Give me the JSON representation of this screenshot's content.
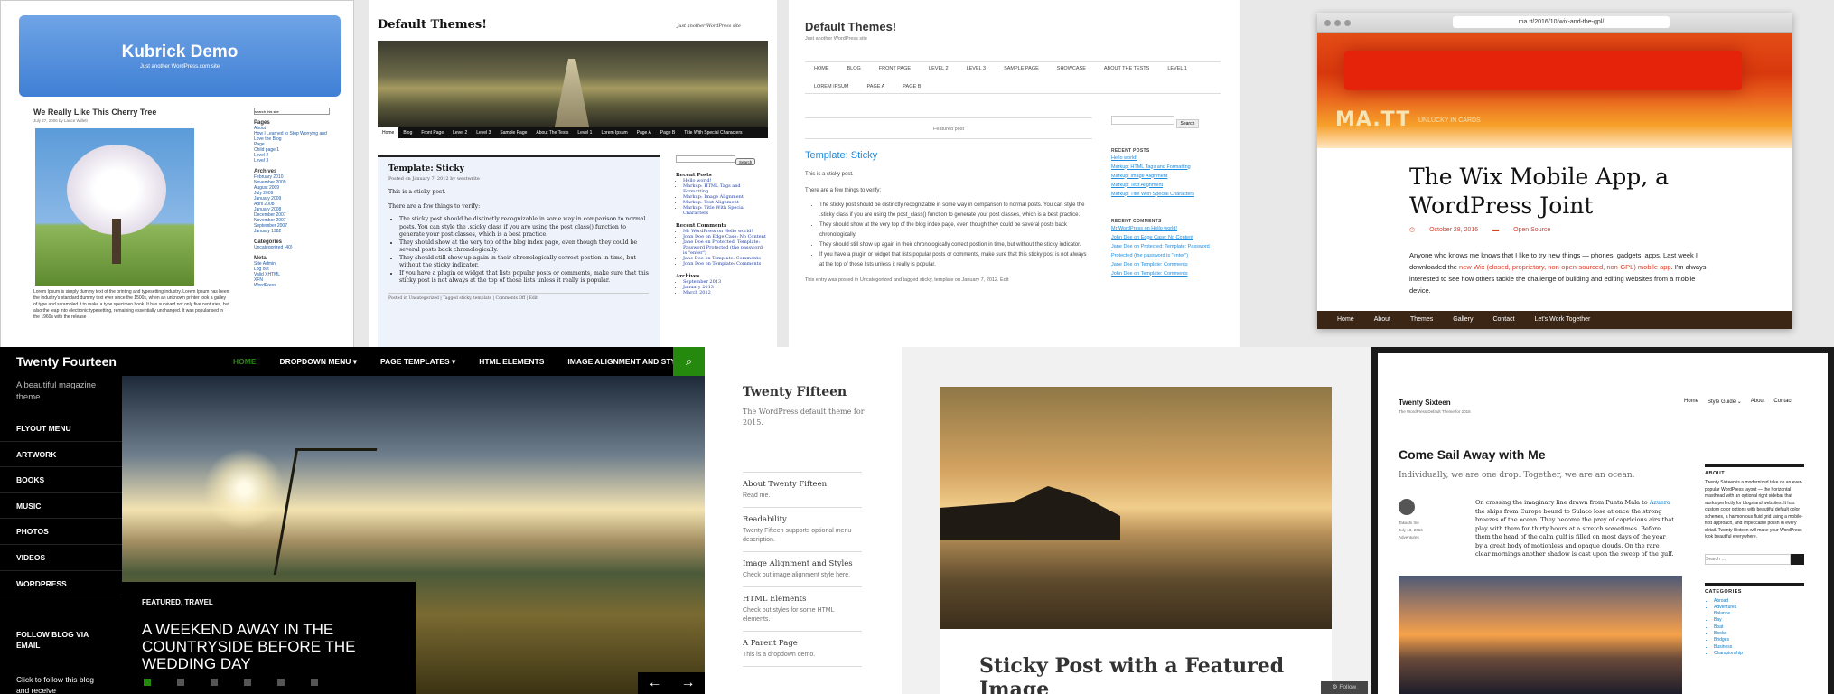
{
  "kubrick": {
    "title": "Kubrick Demo",
    "tagline": "Just another WordPress.com site",
    "post_title": "We Really Like This Cherry Tree",
    "post_meta": "July 27, 2006 by Lance Willett",
    "body": "Lorem Ipsum is simply dummy text of the printing and typesetting industry. Lorem Ipsum has been the industry's standard dummy text ever since the 1500s, when an unknown printer took a galley of type and scrambled it to make a type specimen book. It has survived not only five centuries, but also the leap into electronic typesetting, remaining essentially unchanged. It was popularised in the 1960s with the release",
    "search_value": "search this site",
    "pages_heading": "Pages",
    "pages": [
      "About",
      "How I Learned to Stop Worrying and Love the Blog",
      "Page",
      "Child page 1",
      "Level 2",
      "Level 3"
    ],
    "archives_heading": "Archives",
    "archives": [
      "February 2010",
      "November 2009",
      "August 2009",
      "July 2009",
      "January 2009",
      "April 2008",
      "January 2008",
      "December 2007",
      "November 2007",
      "September 2007",
      "January 1982"
    ],
    "categories_heading": "Categories",
    "categories": [
      "Uncategorized (40)"
    ],
    "meta_heading": "Meta",
    "meta": [
      "Site Admin",
      "Log out",
      "Valid XHTML",
      "XFN",
      "WordPress"
    ]
  },
  "default_serif": {
    "title": "Default Themes!",
    "tagline": "Just another WordPress site",
    "nav": [
      "Home",
      "Blog",
      "Front Page",
      "Level 2",
      "Level 3",
      "Sample Page",
      "About The Tests",
      "Level 1",
      "Lorem Ipsum",
      "Page A",
      "Page B",
      "Title With Special Characters"
    ],
    "post_title": "Template: Sticky",
    "post_meta": "Posted on January 7, 2012 by westwrite",
    "p1": "This is a sticky post.",
    "p2": "There are a few things to verify:",
    "bullets": [
      "The sticky post should be distinctly recognizable in some way in comparison to normal posts. You can style the .sticky class if you are using the post_class() function to generate your post classes, which is a best practice.",
      "They should show at the very top of the blog index page, even though they could be several posts back chronologically.",
      "They should still show up again in their chronologically correct postion in time, but without the sticky indicator.",
      "If you have a plugin or widget that lists popular posts or comments, make sure that this sticky post is not always at the top of those lists unless it really is popular."
    ],
    "foot": "Posted in Uncategorized | Tagged sticky, template | Comments Off | Edit",
    "search_button": "Search",
    "recent_posts_heading": "Recent Posts",
    "recent_posts": [
      "Hello world!",
      "Markup: HTML Tags and Formatting",
      "Markup: Image Alignment",
      "Markup: Text Alignment",
      "Markup: Title With Special Characters"
    ],
    "recent_comments_heading": "Recent Comments",
    "recent_comments": [
      "Mr WordPress on Hello world!",
      "John Doe on Edge Case: No Content",
      "Jane Doe on Protected: Template: Password Protected (the password is \"enter\")",
      "Jane Doe on Template: Comments",
      "John Doe on Template: Comments"
    ],
    "archives_heading": "Archives",
    "archives": [
      "September 2013",
      "January 2013",
      "March 2012"
    ]
  },
  "twenty_eleven": {
    "title": "Default Themes!",
    "tagline": "Just another WordPress site",
    "menu": [
      "HOME",
      "BLOG",
      "FRONT PAGE",
      "LEVEL 2",
      "LEVEL 3",
      "SAMPLE PAGE",
      "SHOWCASE",
      "ABOUT THE TESTS",
      "LEVEL 1",
      "LOREM IPSUM",
      "PAGE A",
      "PAGE B"
    ],
    "featured": "Featured post",
    "post_title": "Template: Sticky",
    "p1": "This is a sticky post.",
    "p2": "There are a few things to verify:",
    "bullets": [
      "The sticky post should be distinctly recognizable in some way in comparison to normal posts. You can style the .sticky class if you are using the post_class() function to generate your post classes, which is a best practice.",
      "They should show at the very top of the blog index page, even though they could be several posts back chronologically.",
      "They should still show up again in their chronologically correct postion in time, but without the sticky indicator.",
      "If you have a plugin or widget that lists popular posts or comments, make sure that this sticky post is not always at the top of those lists unless it really is popular."
    ],
    "foot": "This entry was posted in Uncategorized and tagged sticky, template on January 7, 2012. Edit",
    "search_button": "Search",
    "recent_posts_heading": "RECENT POSTS",
    "recent_posts": [
      "Hello world!",
      "Markup: HTML Tags and Formatting",
      "Markup: Image Alignment",
      "Markup: Text Alignment",
      "Markup: Title With Special Characters"
    ],
    "recent_comments_heading": "RECENT COMMENTS",
    "recent_comments": [
      "Mr WordPress on Hello world!",
      "John Doe on Edge Case: No Content",
      "Jane Doe on Protected: Template: Password Protected (the password is \"enter\")",
      "Jane Doe on Template: Comments",
      "John Doe on Template: Comments"
    ]
  },
  "matt": {
    "url": "ma.tt/2016/10/wix-and-the-gpl/",
    "logo": "MA.TT",
    "logo_tag": "UNLUCKY IN CARDS",
    "post_title": "The Wix Mobile App, a WordPress Joint",
    "date": "October 28, 2016",
    "category": "Open Source",
    "text_a": "Anyone who knows me knows that I like to try new things — phones, gadgets, apps. Last week I downloaded the ",
    "link": "new Wix (closed, proprietary, non-open-sourced, non-GPL) mobile app",
    "text_b": ". I'm always interested to see how others tackle the challenge of building and editing websites from a mobile device.",
    "footer_nav": [
      "Home",
      "About",
      "Themes",
      "Gallery",
      "Contact",
      "Let's Work Together"
    ]
  },
  "twenty_fourteen": {
    "site_title": "Twenty Fourteen",
    "description": "A beautiful magazine theme",
    "menu": [
      "HOME",
      "DROPDOWN MENU ▾",
      "PAGE TEMPLATES ▾",
      "HTML ELEMENTS",
      "IMAGE ALIGNMENT AND STYLES"
    ],
    "secondary_menu": [
      "FLYOUT MENU",
      "ARTWORK",
      "BOOKS",
      "MUSIC",
      "PHOTOS",
      "VIDEOS",
      "WORDPRESS"
    ],
    "follow_heading": "FOLLOW BLOG VIA EMAIL",
    "follow_text": "Click to follow this blog and receive",
    "featured_cat": "FEATURED, TRAVEL",
    "featured_title": "A WEEKEND AWAY IN THE COUNTRYSIDE BEFORE THE WEDDING DAY",
    "accent": "#24890d"
  },
  "twenty_fifteen": {
    "site_title": "Twenty Fifteen",
    "description": "The WordPress default theme for 2015.",
    "nav": [
      {
        "title": "About Twenty Fifteen",
        "sub": "Read me."
      },
      {
        "title": "Readability",
        "sub": "Twenty Fifteen supports optional menu description."
      },
      {
        "title": "Image Alignment and Styles",
        "sub": "Check out image alignment style here."
      },
      {
        "title": "HTML Elements",
        "sub": "Check out styles for some HTML elements."
      },
      {
        "title": "A Parent Page",
        "sub": "This is a dropdown demo."
      }
    ],
    "post_title": "Sticky Post with a Featured Image",
    "follow": "Follow"
  },
  "twenty_sixteen": {
    "site_title": "Twenty Sixteen",
    "description": "The WordPress Default Theme for 2016",
    "menu": [
      "Home",
      "Style Guide ⌄",
      "About",
      "Contact"
    ],
    "post_title": "Come Sail Away with Me",
    "excerpt": "Individually, we are one drop. Together, we are an ocean.",
    "author": "Takashi Irie",
    "date": "July 19, 2016",
    "category": "Adventures",
    "text_a": "On crossing the imaginary line drawn from Punta Mala to ",
    "link": "Azuera",
    "text_b": " the ships from Europe bound to Sulaco lose at once the strong breezes of the ocean. They become the prey of capricious airs that play with them for thirty hours at a stretch sometimes. Before them the head of the calm gulf is filled on most days of the year by a great body of motionless and opaque clouds. On the rare clear mornings another shadow is cast upon the sweep of the gulf.",
    "about_heading": "ABOUT",
    "about_text": "Twenty Sixteen is a modernized take on an ever-popular WordPress layout — the horizontal masthead with an optional right sidebar that works perfectly for blogs and websites. It has custom color options with beautiful default color schemes, a harmonious fluid grid using a mobile-first approach, and impeccable polish in every detail. Twenty Sixteen will make your WordPress look beautiful everywhere.",
    "search_placeholder": "Search …",
    "categories_heading": "CATEGORIES",
    "categories": [
      "Abroad",
      "Adventures",
      "Balance",
      "Bay",
      "Boat",
      "Books",
      "Bridges",
      "Business",
      "Championship"
    ]
  }
}
